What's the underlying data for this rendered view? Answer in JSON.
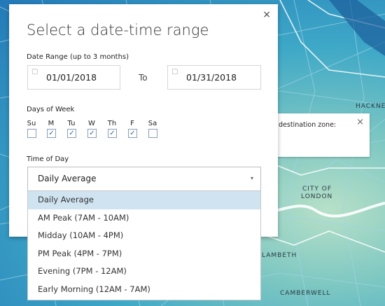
{
  "map": {
    "labels": [
      "HACKNE",
      "CITY OF",
      "LONDON",
      "LAMBETH",
      "CAMBERWELL"
    ]
  },
  "info_popup": {
    "text": "destination zone:",
    "close": "×"
  },
  "modal": {
    "close": "×",
    "title": "Select a date-time range",
    "date_range_label": "Date Range (up to 3 months)",
    "start_date": "01/01/2018",
    "to_label": "To",
    "end_date": "01/31/2018",
    "days_label": "Days of Week",
    "days": [
      {
        "label": "Su",
        "checked": false
      },
      {
        "label": "M",
        "checked": true
      },
      {
        "label": "Tu",
        "checked": true
      },
      {
        "label": "W",
        "checked": true
      },
      {
        "label": "Th",
        "checked": true
      },
      {
        "label": "F",
        "checked": true
      },
      {
        "label": "Sa",
        "checked": false
      }
    ],
    "time_label": "Time of Day",
    "time_selected": "Daily Average",
    "time_options": [
      "Daily Average",
      "AM Peak (7AM - 10AM)",
      "Midday (10AM - 4PM)",
      "PM Peak (4PM - 7PM)",
      "Evening (7PM - 12AM)",
      "Early Morning (12AM - 7AM)"
    ]
  }
}
